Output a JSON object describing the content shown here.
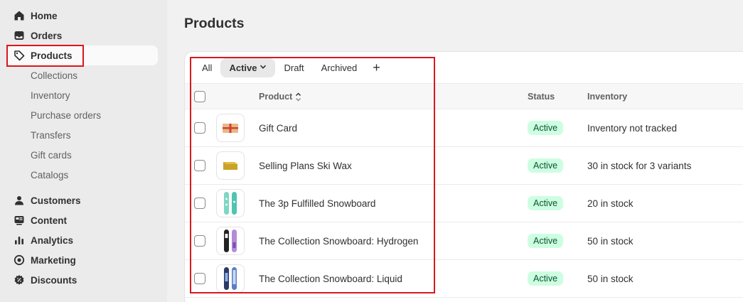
{
  "sidebar": {
    "items": [
      {
        "label": "Home",
        "icon": "home-icon"
      },
      {
        "label": "Orders",
        "icon": "inbox-icon"
      },
      {
        "label": "Products",
        "icon": "tag-icon"
      }
    ],
    "product_subitems": [
      "Collections",
      "Inventory",
      "Purchase orders",
      "Transfers",
      "Gift cards",
      "Catalogs"
    ],
    "lower_items": [
      {
        "label": "Customers",
        "icon": "person-icon"
      },
      {
        "label": "Content",
        "icon": "content-icon"
      },
      {
        "label": "Analytics",
        "icon": "bar-chart-icon"
      },
      {
        "label": "Marketing",
        "icon": "target-icon"
      },
      {
        "label": "Discounts",
        "icon": "gear-discount-icon"
      }
    ]
  },
  "page": {
    "title": "Products"
  },
  "tabs": {
    "all": "All",
    "active": "Active",
    "draft": "Draft",
    "archived": "Archived",
    "add": "+"
  },
  "table": {
    "headers": {
      "product": "Product",
      "status": "Status",
      "inventory": "Inventory"
    },
    "rows": [
      {
        "name": "Gift Card",
        "status": "Active",
        "inventory": "Inventory not tracked"
      },
      {
        "name": "Selling Plans Ski Wax",
        "status": "Active",
        "inventory": "30 in stock for 3 variants"
      },
      {
        "name": "The 3p Fulfilled Snowboard",
        "status": "Active",
        "inventory": "20 in stock"
      },
      {
        "name": "The Collection Snowboard: Hydrogen",
        "status": "Active",
        "inventory": "50 in stock"
      },
      {
        "name": "The Collection Snowboard: Liquid",
        "status": "Active",
        "inventory": "50 in stock"
      }
    ]
  },
  "colors": {
    "highlight": "#d9181d",
    "badge_bg": "#cdfee1",
    "badge_text": "#0c5132"
  }
}
